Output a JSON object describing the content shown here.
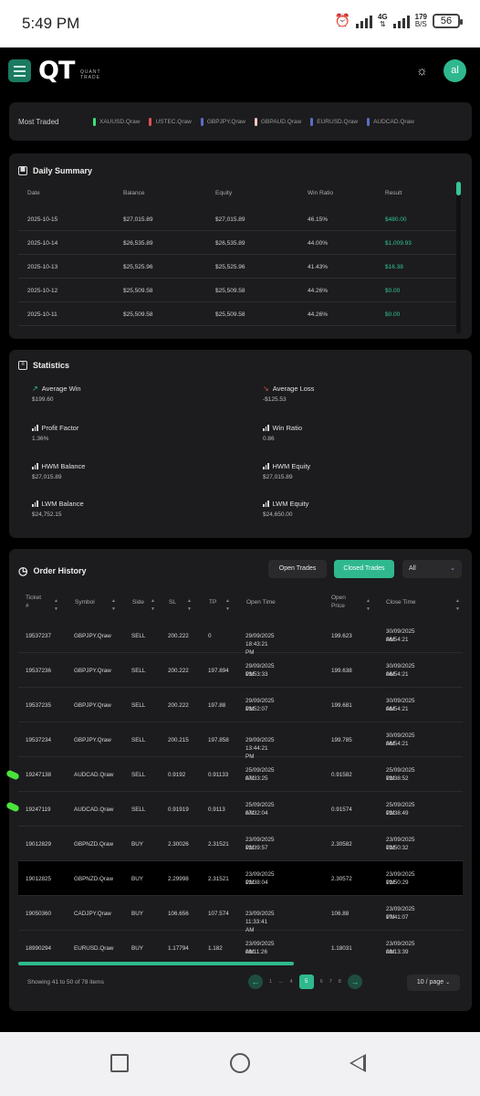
{
  "status_bar": {
    "time": "5:49 PM",
    "network": "4G",
    "speed_value": "179",
    "speed_unit": "B/S",
    "battery": "56"
  },
  "header": {
    "logo": "QT",
    "logo_sub_1": "QUANT",
    "logo_sub_2": "TRADE",
    "avatar": "al"
  },
  "most_traded": {
    "label": "Most Traded",
    "symbols": [
      {
        "name": "XAUUSD.Qraw",
        "color": "#3ee07a"
      },
      {
        "name": "USTEC.Qraw",
        "color": "#e05252"
      },
      {
        "name": "GBPJPY.Qraw",
        "color": "#5b6cc9"
      },
      {
        "name": "GBPAUD.Qraw",
        "color": "#f2c7b8"
      },
      {
        "name": "EURUSD.Qraw",
        "color": "#5b6cc9"
      },
      {
        "name": "AUDCAD.Qraw",
        "color": "#5b6cc9"
      }
    ]
  },
  "daily_summary": {
    "title": "Daily Summary",
    "columns": [
      "Date",
      "Balance",
      "Equity",
      "Win Ratio",
      "Result"
    ],
    "rows": [
      [
        "2025-10-15",
        "$27,015.89",
        "$27,015.89",
        "46.15%",
        "$480.00"
      ],
      [
        "2025-10-14",
        "$26,535.89",
        "$26,535.89",
        "44.00%",
        "$1,009.93"
      ],
      [
        "2025-10-13",
        "$25,525.96",
        "$25,525.96",
        "41.43%",
        "$16.38"
      ],
      [
        "2025-10-12",
        "$25,509.58",
        "$25,509.58",
        "44.26%",
        "$0.00"
      ],
      [
        "2025-10-11",
        "$25,509.58",
        "$25,509.58",
        "44.26%",
        "$0.00"
      ]
    ]
  },
  "statistics": {
    "title": "Statistics",
    "items": [
      {
        "label": "Average Win",
        "value": "$199.60"
      },
      {
        "label": "Average Loss",
        "value": "-$125.53"
      },
      {
        "label": "Profit Factor",
        "value": "1.36%"
      },
      {
        "label": "Win Ratio",
        "value": "0.86"
      },
      {
        "label": "HWM Balance",
        "value": "$27,015.89"
      },
      {
        "label": "HWM Equity",
        "value": "$27,015.89"
      },
      {
        "label": "LWM Balance",
        "value": "$24,752.15"
      },
      {
        "label": "LWM Equity",
        "value": "$24,650.00"
      }
    ]
  },
  "order_history": {
    "title": "Order History",
    "open_trades": "Open Trades",
    "closed_trades": "Closed Trades",
    "filter": "All",
    "columns": {
      "ticket_1": "Ticket",
      "ticket_2": "#",
      "symbol": "Symbol",
      "side": "Side",
      "sl": "SL",
      "tp": "TP",
      "open_time": "Open Time",
      "open_price_1": "Open",
      "open_price_2": "Price",
      "close_time": "Close Time"
    },
    "rows": [
      {
        "ticket": "19537237",
        "symbol": "GBPJPY.Qraw",
        "side": "SELL",
        "sl": "200.222",
        "tp": "0",
        "open_time_1": "29/09/2025 18:43:21 PM",
        "open_time_2": "",
        "open_price": "199.623",
        "close_time_1": "30/09/2025 06:54:21",
        "close_time_2": "AM"
      },
      {
        "ticket": "19537236",
        "symbol": "GBPJPY.Qraw",
        "side": "SELL",
        "sl": "200.222",
        "tp": "197.894",
        "open_time_1": "29/09/2025 13:53:33",
        "open_time_2": "PM",
        "open_price": "199.638",
        "close_time_1": "30/09/2025 06:54:21",
        "close_time_2": "AM"
      },
      {
        "ticket": "19537235",
        "symbol": "GBPJPY.Qraw",
        "side": "SELL",
        "sl": "200.222",
        "tp": "197.88",
        "open_time_1": "29/09/2025 13:52:07",
        "open_time_2": "PM",
        "open_price": "199.681",
        "close_time_1": "30/09/2025 06:54:21",
        "close_time_2": "AM"
      },
      {
        "ticket": "19537234",
        "symbol": "GBPJPY.Qraw",
        "side": "SELL",
        "sl": "200.215",
        "tp": "197.858",
        "open_time_1": "29/09/2025 13:44:21 PM",
        "open_time_2": "",
        "open_price": "199.785",
        "close_time_1": "30/09/2025 06:54:21",
        "close_time_2": "AM"
      },
      {
        "ticket": "19247138",
        "symbol": "AUDCAD.Qraw",
        "side": "SELL",
        "sl": "0.9192",
        "tp": "0.91133",
        "open_time_1": "25/09/2025 07:33:25",
        "open_time_2": "AM",
        "open_price": "0.91582",
        "close_time_1": "25/09/2025 12:38:52",
        "close_time_2": "PM"
      },
      {
        "ticket": "19247119",
        "symbol": "AUDCAD.Qraw",
        "side": "SELL",
        "sl": "0.91919",
        "tp": "0.9113",
        "open_time_1": "25/09/2025 07:32:04",
        "open_time_2": "AM",
        "open_price": "0.91574",
        "close_time_1": "25/09/2025 12:38:49",
        "close_time_2": "PM"
      },
      {
        "ticket": "19012829",
        "symbol": "GBPNZD.Qraw",
        "side": "BUY",
        "sl": "2.30026",
        "tp": "2.31521",
        "open_time_1": "23/09/2025 12:39:57",
        "open_time_2": "PM",
        "open_price": "2.30582",
        "close_time_1": "23/09/2025 12:50:32",
        "close_time_2": "PM"
      },
      {
        "ticket": "19012825",
        "symbol": "GBPNZD.Qraw",
        "side": "BUY",
        "sl": "2.29998",
        "tp": "2.31521",
        "open_time_1": "23/09/2025 12:38:04",
        "open_time_2": "PM",
        "open_price": "2.30572",
        "close_time_1": "23/09/2025 12:50:29",
        "close_time_2": "PM"
      },
      {
        "ticket": "19050360",
        "symbol": "CADJPY.Qraw",
        "side": "BUY",
        "sl": "106.656",
        "tp": "107.574",
        "open_time_1": "23/09/2025 11:33:41 AM",
        "open_time_2": "",
        "open_price": "106.88",
        "close_time_1": "23/09/2025 17:41:07",
        "close_time_2": "PM"
      },
      {
        "ticket": "18990294",
        "symbol": "EURUSD.Qraw",
        "side": "BUY",
        "sl": "1.17794",
        "tp": "1.182",
        "open_time_1": "23/09/2025 09:11:26",
        "open_time_2": "AM",
        "open_price": "1.18031",
        "close_time_1": "23/09/2025 09:13:39",
        "close_time_2": "AM"
      }
    ],
    "showing": "Showing 41 to 50 of 78 items",
    "pages": [
      "1",
      "…",
      "4",
      "5",
      "6",
      "7",
      "8"
    ],
    "current_page": "5",
    "page_size": "10 / page"
  }
}
